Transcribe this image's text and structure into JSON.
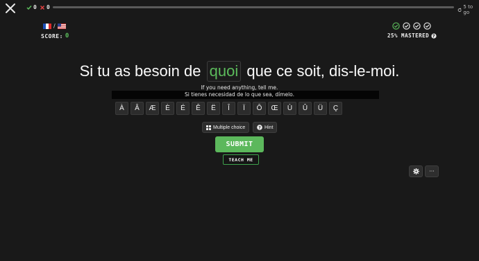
{
  "topbar": {
    "correct_count": "0",
    "wrong_count": "0",
    "remaining_label": "5 to go",
    "progress": 0
  },
  "languages": {
    "from_flag": "french-flag",
    "to_flag": "us-flag",
    "separator": "/"
  },
  "score": {
    "label": "SCORE:",
    "value": "0"
  },
  "mastery": {
    "circles_done": 4,
    "label": "25% MASTERED"
  },
  "sentence": {
    "before": "Si tu as besoin de",
    "answer": "quoi",
    "after": "que ce soit, dis-le-moi."
  },
  "translations": {
    "english": "If you need anything, tell me.",
    "spanish": "Si tienes necesidad de lo que sea, dímelo."
  },
  "accents": [
    "À",
    "Â",
    "Æ",
    "È",
    "É",
    "Ê",
    "Ë",
    "Î",
    "Ï",
    "Ô",
    "Œ",
    "Ù",
    "Û",
    "Ü",
    "Ç"
  ],
  "buttons": {
    "multiple_choice": "Multiple choice",
    "hint": "Hint",
    "submit": "SUBMIT",
    "teach_me": "TEACH ME",
    "more": "···"
  },
  "colors": {
    "accent": "#5cb85c",
    "background": "#191919"
  }
}
